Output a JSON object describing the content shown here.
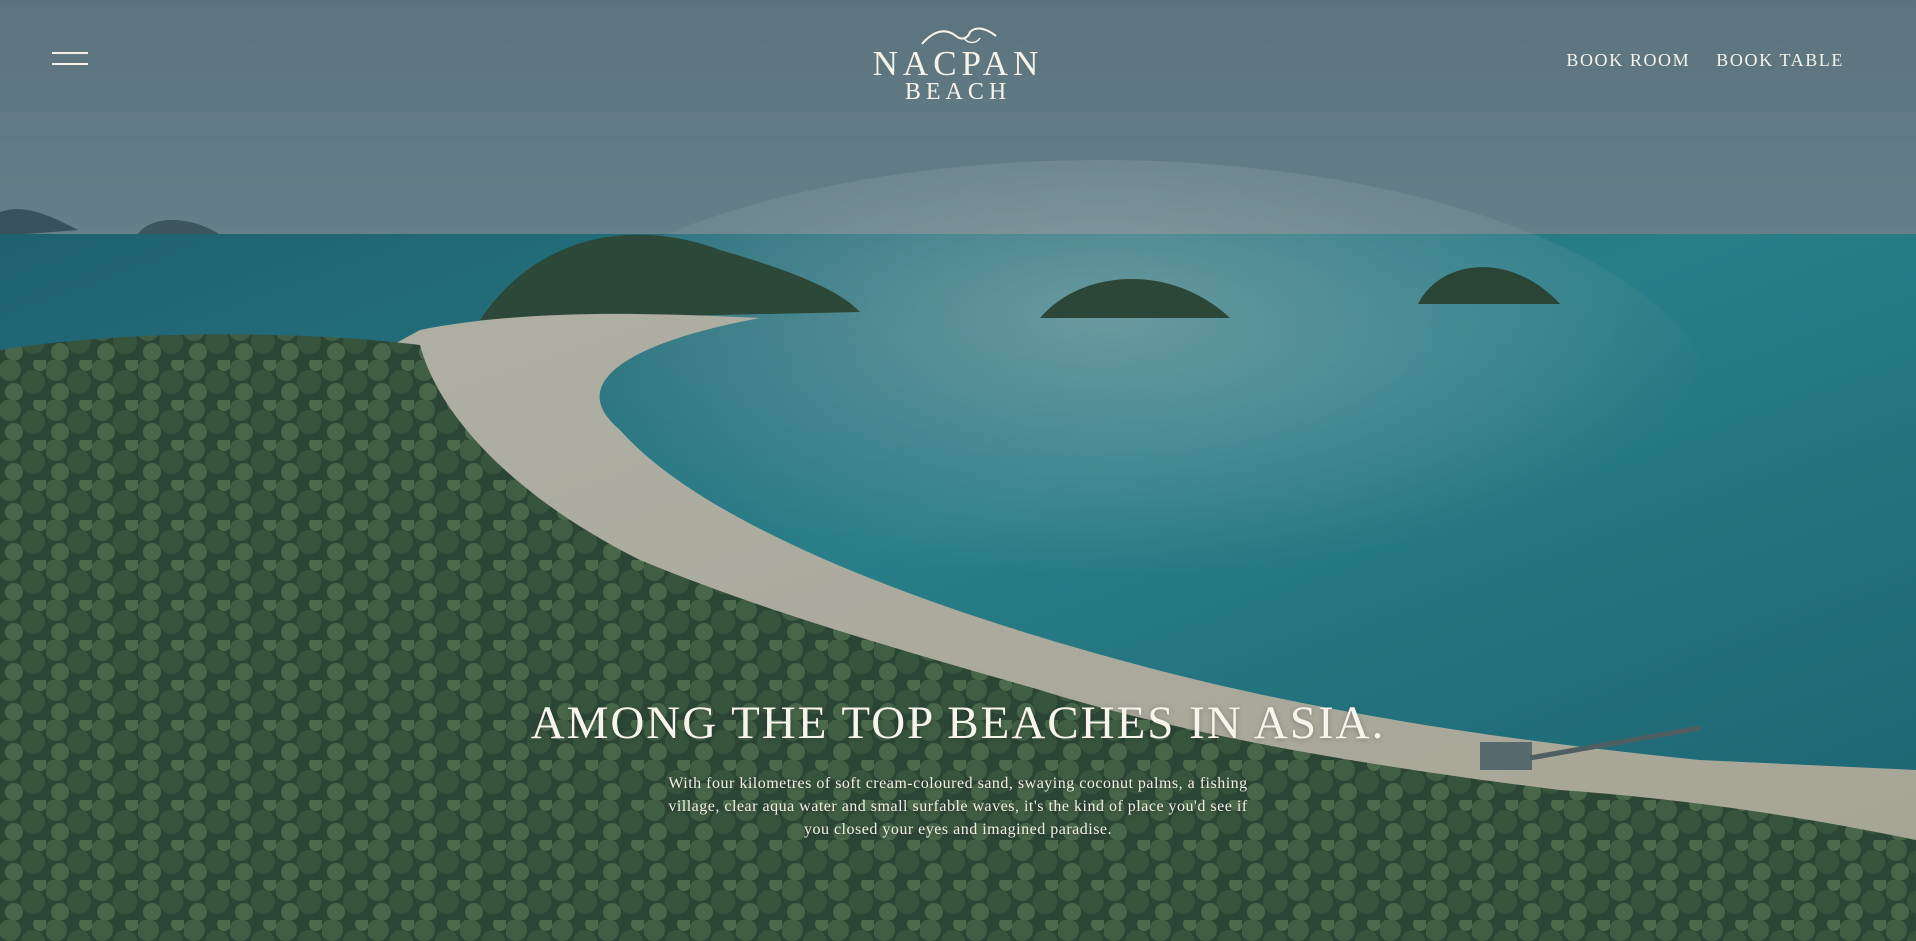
{
  "header": {
    "logo": {
      "line1": "NACPAN",
      "line2": "BEACH"
    },
    "nav": {
      "book_room_label": "BOOK ROOM",
      "book_table_label": "BOOK TABLE"
    }
  },
  "hero": {
    "headline": "AMONG THE TOP BEACHES IN ASIA.",
    "description": "With four kilometres of soft cream-coloured sand, swaying coconut palms, a fishing village, clear aqua water and small surfable waves, it's the kind of place you'd see if you closed your eyes and imagined paradise."
  },
  "icons": {
    "menu": "hamburger-menu-icon",
    "logo_wave": "wave-icon"
  },
  "colors": {
    "sea": "#1f8c93",
    "sand": "#e6dcc6",
    "palm": "#3c5a3a",
    "text": "#f6f3ea"
  }
}
